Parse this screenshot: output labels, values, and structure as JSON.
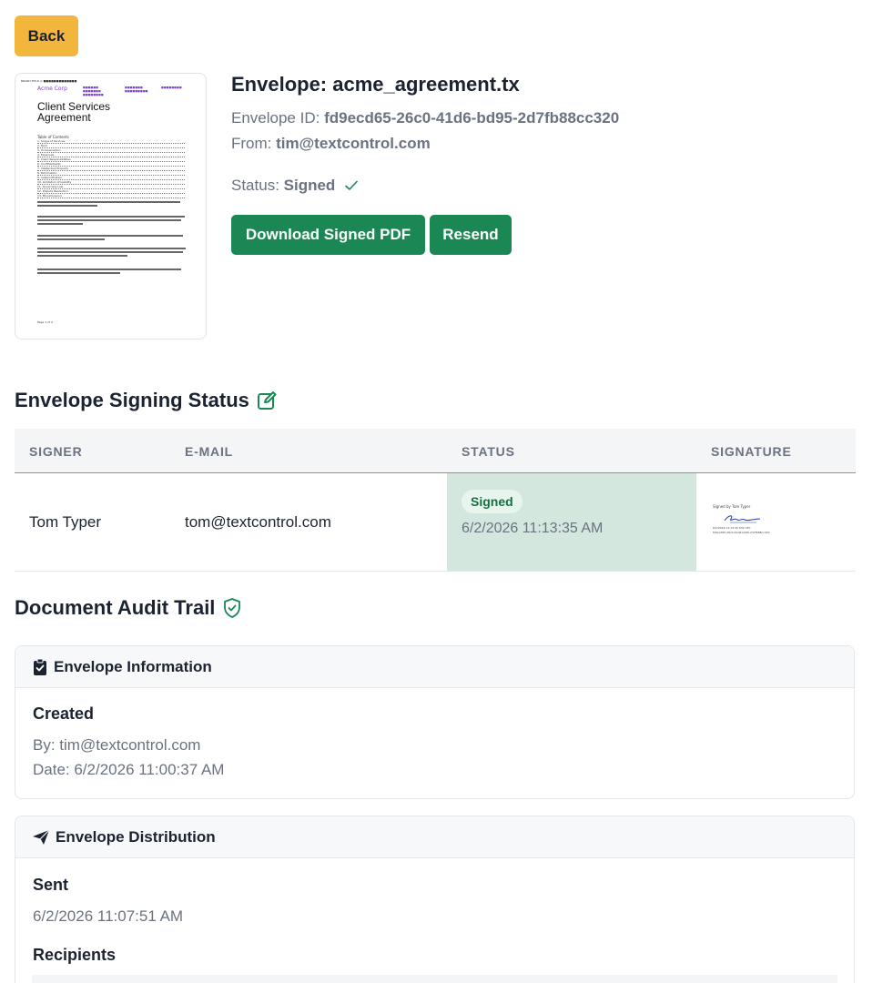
{
  "back_label": "Back",
  "thumbnail": {
    "header_small": "BRAND FIELD ◎ ■■■■■■■■■■■■■",
    "company": "Acme Corp",
    "title_line1": "Client Services",
    "title_line2": "Agreement",
    "toc_heading": "Table of Contents",
    "toc": [
      "1. Scope of Services",
      "2. Term",
      "3. Compensation",
      "4. Expenses",
      "5. Client Responsibilities",
      "6. Confidentiality",
      "7. Intellectual Property",
      "8. Termination",
      "9. Indemnification",
      "10. Limitation of Liability",
      "11. Governing Law",
      "12. Dispute Resolution",
      "13. Miscellaneous"
    ],
    "footer": "Page 1 of 4"
  },
  "envelope": {
    "title": "Envelope: acme_agreement.tx",
    "id_label": "Envelope ID: ",
    "id_value": "fd9ecd65-26c0-41d6-bd95-2d7fb88cc320",
    "from_label": "From: ",
    "from_value": "tim@textcontrol.com",
    "status_label": "Status: ",
    "status_value": "Signed"
  },
  "actions": {
    "download": "Download Signed PDF",
    "resend": "Resend"
  },
  "signing_status": {
    "title": "Envelope Signing Status",
    "columns": [
      "SIGNER",
      "E-MAIL",
      "STATUS",
      "SIGNATURE"
    ],
    "row": {
      "signer": "Tom Typer",
      "email": "tom@textcontrol.com",
      "status_badge": "Signed",
      "status_time": "6/2/2026 11:13:35 AM",
      "sig_caption": "Signed by Tom Typer",
      "sig_meta1": "6/2/2026 11:13:35.532 UTC",
      "sig_meta2": "fd9ecd65-26c0-41d6-bd95-2d7fb88cc320"
    }
  },
  "audit": {
    "title": "Document Audit Trail",
    "info_card": {
      "title": "Envelope Information",
      "sub": "Created",
      "by": "By: tim@textcontrol.com",
      "date": "Date: 6/2/2026 11:00:37 AM"
    },
    "dist_card": {
      "title": "Envelope Distribution",
      "sub": "Sent",
      "date": "6/2/2026 11:07:51 AM",
      "recipients": "Recipients"
    }
  },
  "colors": {
    "accent_yellow": "#f2b63c",
    "accent_green": "#1a8754",
    "status_cell_bg": "#d3e7de"
  }
}
